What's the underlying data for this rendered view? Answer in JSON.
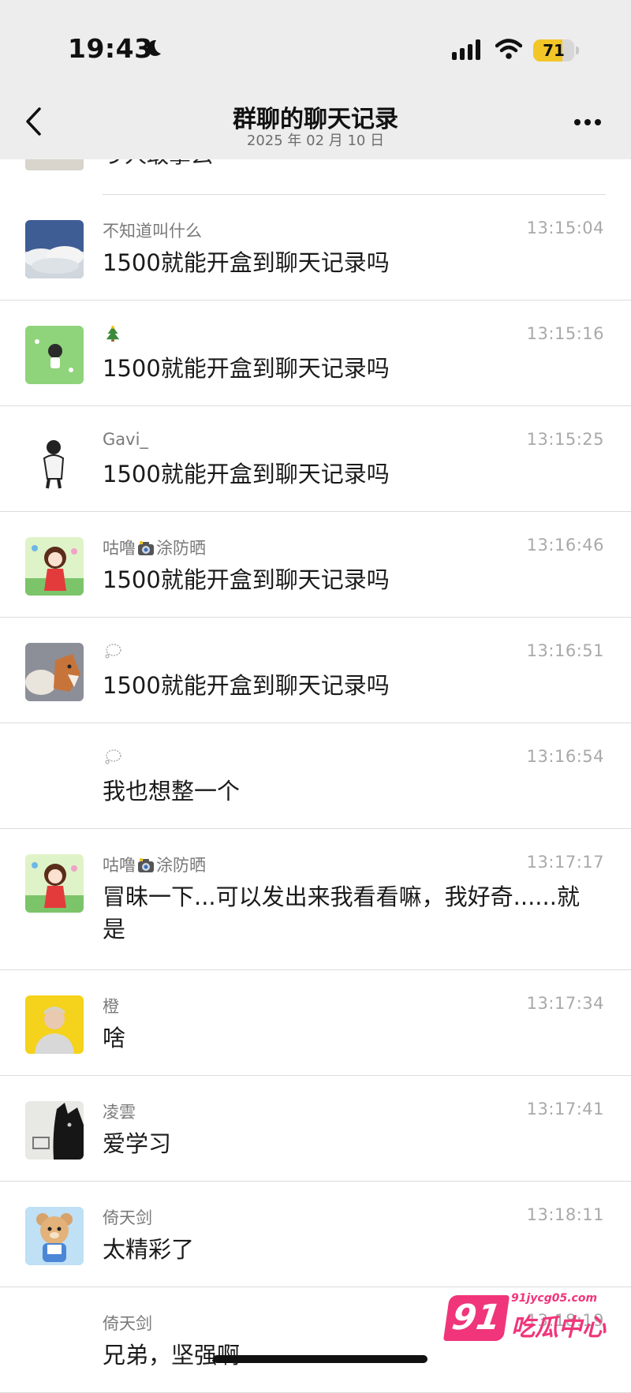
{
  "status_bar": {
    "time": "19:43",
    "battery": "71",
    "battery_level": 0.71
  },
  "header": {
    "title": "群聊的聊天记录",
    "date": "2025 年 02 月 10 日"
  },
  "partial_previous": {
    "text": "う人敢拿么"
  },
  "messages": [
    {
      "sender": "不知道叫什么",
      "time": "13:15:04",
      "text": "1500就能开盒到聊天记录吗",
      "avatar": "sky-clouds-avatar"
    },
    {
      "sender": "",
      "sender_icon": "christmas-tree-icon",
      "time": "13:15:16",
      "text": "1500就能开盒到聊天记录吗",
      "avatar": "green-field-girl-avatar"
    },
    {
      "sender": "Gavi_",
      "time": "13:15:25",
      "text": "1500就能开盒到聊天记录吗",
      "avatar": "sketch-man-avatar"
    },
    {
      "sender_pre": "咕噜",
      "sender_icon": "camera-icon",
      "sender_post": "涂防晒",
      "time": "13:16:46",
      "text": "1500就能开盒到聊天记录吗",
      "avatar": "cartoon-girl-avatar"
    },
    {
      "sender": "",
      "sender_icon": "thought-bubble-icon",
      "time": "13:16:51",
      "text": "1500就能开盒到聊天记录吗",
      "avatar": "shiba-dog-avatar"
    },
    {
      "sender": "",
      "sender_icon": "thought-bubble-icon",
      "time": "13:16:54",
      "text": "我也想整一个",
      "avatar": ""
    },
    {
      "sender_pre": "咕噜",
      "sender_icon": "camera-icon",
      "sender_post": "涂防晒",
      "time": "13:17:17",
      "text": "冒昧一下...可以发出来我看看嘛，我好奇......就是",
      "avatar": "cartoon-girl-avatar"
    },
    {
      "sender": "橙",
      "time": "13:17:34",
      "text": "啥",
      "avatar": "yellow-portrait-avatar"
    },
    {
      "sender": "凌雲",
      "time": "13:17:41",
      "text": "爱学习",
      "avatar": "black-cat-avatar"
    },
    {
      "sender": "倚天剑",
      "time": "13:18:11",
      "text": "太精彩了",
      "avatar": "bear-avatar"
    },
    {
      "sender": "倚天剑",
      "time": "13:18:19",
      "text": "兄弟，坚强啊",
      "avatar": ""
    }
  ],
  "watermark": {
    "logo": "91",
    "url": "91jycg05.com",
    "name": "吃瓜中心"
  },
  "colors": {
    "header_bg": "#ededed",
    "battery": "#f3c627",
    "watermark": "#f0357a"
  }
}
